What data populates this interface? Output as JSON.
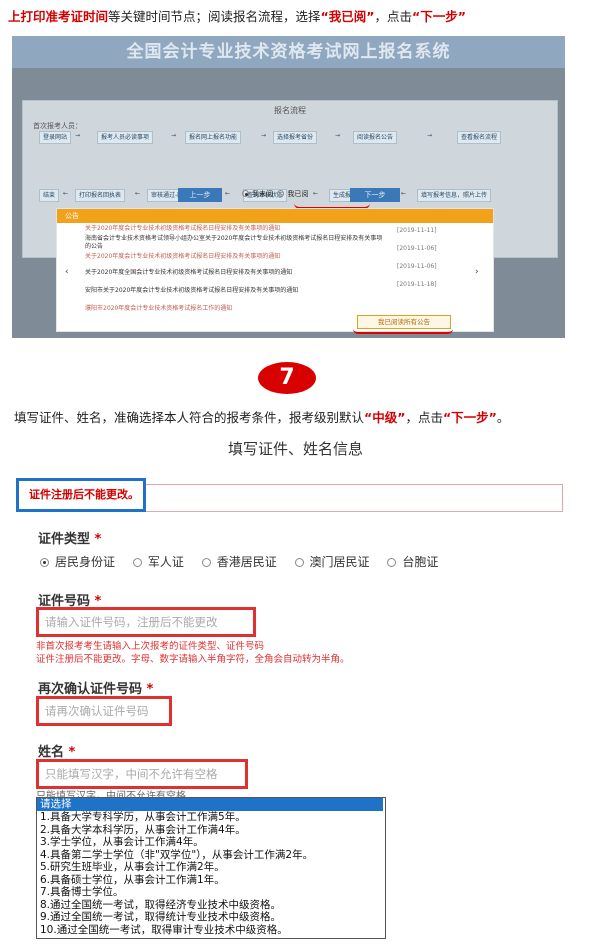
{
  "intro1": {
    "part1": "上打印准考证时间",
    "part2": "等关键时间节点；阅读报名流程，选择",
    "part3": "“我已阅”",
    "part4": "，点击",
    "part5": "“下一步”"
  },
  "shot1": {
    "banner": "全国会计专业技术资格考试网上报名系统",
    "flow_title": "报名流程",
    "flow_sub": "首次报考人员：",
    "steps_row1": [
      "登录网站",
      "报考人员必读事项",
      "报名网上报名功能",
      "选择报考省份",
      "阅读报名公告",
      "查看报名流程"
    ],
    "steps_row2": [
      "结束",
      "打印报名回执表",
      "审核通过-网上交费",
      "查询审核状态",
      "生成报名注册号",
      "填写报考信息，照片上传"
    ],
    "prev_btn": "上一步",
    "radio_not_read": "我未阅",
    "radio_read": "我已阅",
    "next_btn": "下一步",
    "notice_head": "公告",
    "notices": [
      "关于2020年度会计专业技术初级资格考试报名日程安排及有关事项的通知",
      "海南省会计专业技术资格考试领导小组办公室关于2020年度会计专业技术初级资格考试报名日程安排及有关事项的公告",
      "关于2020年度会计专业技术初级资格考试报名日程安排及有关事项的通知",
      "关于2020年度全国会计专业技术初级资格考试报名日程安排及有关事项的通知",
      "安阳市关于2020年度会计专业技术初级资格考试报名日程安排及有关事项的通知",
      "濮阳市2020年度会计专业技术资格考试报名工作的通知"
    ],
    "dates": [
      "[2019-11-11]",
      "[2019-11-06]",
      "[2019-11-06]",
      "[2019-11-18]"
    ],
    "view_all": "我已阅读所有公告"
  },
  "step_number": "7",
  "intro2": {
    "part1": "填写证件、姓名，准确选择本人符合的报考条件，报考级别默认",
    "part2": "“中级”",
    "part3": "，点击",
    "part4": "“下一步”",
    "part5": "。"
  },
  "form": {
    "title": "填写证件、姓名信息",
    "warning": "证件注册后不能更改。",
    "id_type_label": "证件类型",
    "required_star": "*",
    "id_types": [
      "居民身份证",
      "军人证",
      "香港居民证",
      "澳门居民证",
      "台胞证"
    ],
    "id_number_label": "证件号码",
    "id_number_placeholder": "请输入证件号码，注册后不能更改",
    "hint_line1": "非首次报考考生请输入上次报考的证件类型、证件号码",
    "hint_line2": "证件注册后不能更改。字母、数字请输入半角字符，全角会自动转为半角。",
    "confirm_label": "再次确认证件号码",
    "confirm_placeholder": "请再次确认证件号码",
    "name_label": "姓名",
    "name_placeholder": "只能填写汉字，中间不允许有空格",
    "name_hint_behind": "只能填写汉字，中间不允许有空格",
    "dropdown_head": "请选择",
    "dropdown_items": [
      "1.具备大学专科学历，从事会计工作满5年。",
      "2.具备大学本科学历，从事会计工作满4年。",
      "3.学士学位，从事会计工作满4年。",
      "4.具备第二学士学位（非\"双学位\"），从事会计工作满2年。",
      "5.研究生班毕业，从事会计工作满2年。",
      "6.具备硕士学位，从事会计工作满1年。",
      "7.具备博士学位。",
      "8.通过全国统一考试，取得经济专业技术中级资格。",
      "9.通过全国统一考试，取得统计专业技术中级资格。",
      "10.通过全国统一考试，取得审计专业技术中级资格。"
    ]
  }
}
